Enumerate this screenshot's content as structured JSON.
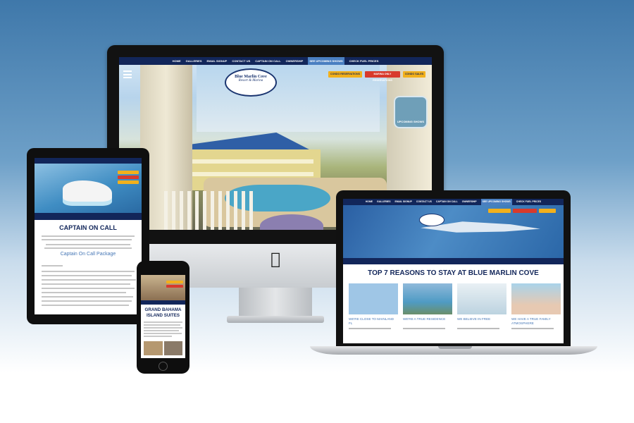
{
  "desktop": {
    "nav": [
      "HOME",
      "GALLERIES",
      "EMAIL SIGNUP",
      "CONTACT US",
      "CAPTAIN ON CALL",
      "OWNERSHIP",
      "SEE UPCOMING SHOWS",
      "CHECK FUEL PRICES"
    ],
    "nav_highlight_index": 6,
    "logo_line1": "Blue Marlin Cove",
    "logo_line2": "Resort & Marina",
    "buttons": [
      "CONDO RESERVATIONS",
      "MARINA ONLY RESERVATIONS",
      "CONDO SALES"
    ],
    "badge": "UPCOMING SHOWS"
  },
  "tablet": {
    "title": "CAPTAIN ON CALL",
    "subtitle": "Captain On Call Package"
  },
  "phone": {
    "title": "GRAND BAHAMA ISLAND SUITES"
  },
  "laptop": {
    "nav": [
      "HOME",
      "GALLERIES",
      "EMAIL SIGNUP",
      "CONTACT US",
      "CAPTAIN ON CALL",
      "OWNERSHIP",
      "SEE UPCOMING SHOWS",
      "CHECK FUEL PRICES"
    ],
    "heading": "TOP 7 REASONS TO STAY AT BLUE MARLIN COVE",
    "cards": [
      {
        "caption": "WE'RE CLOSE TO MAINLAND FL",
        "color": "#9fc6e6"
      },
      {
        "caption": "WE'RE A TRUE RESIDENCE",
        "color": "#4f9bc4"
      },
      {
        "caption": "WE BELIEVE IN FREE",
        "color": "#d8e6ee"
      },
      {
        "caption": "WE HAVE A TRUE FAMILY ATMOSPHERE",
        "color": "#e7c9b2"
      }
    ]
  },
  "colors": {
    "navy": "#12265a",
    "accent_yellow": "#f2b01c",
    "accent_red": "#d83a2c",
    "link_blue": "#4677b6"
  }
}
